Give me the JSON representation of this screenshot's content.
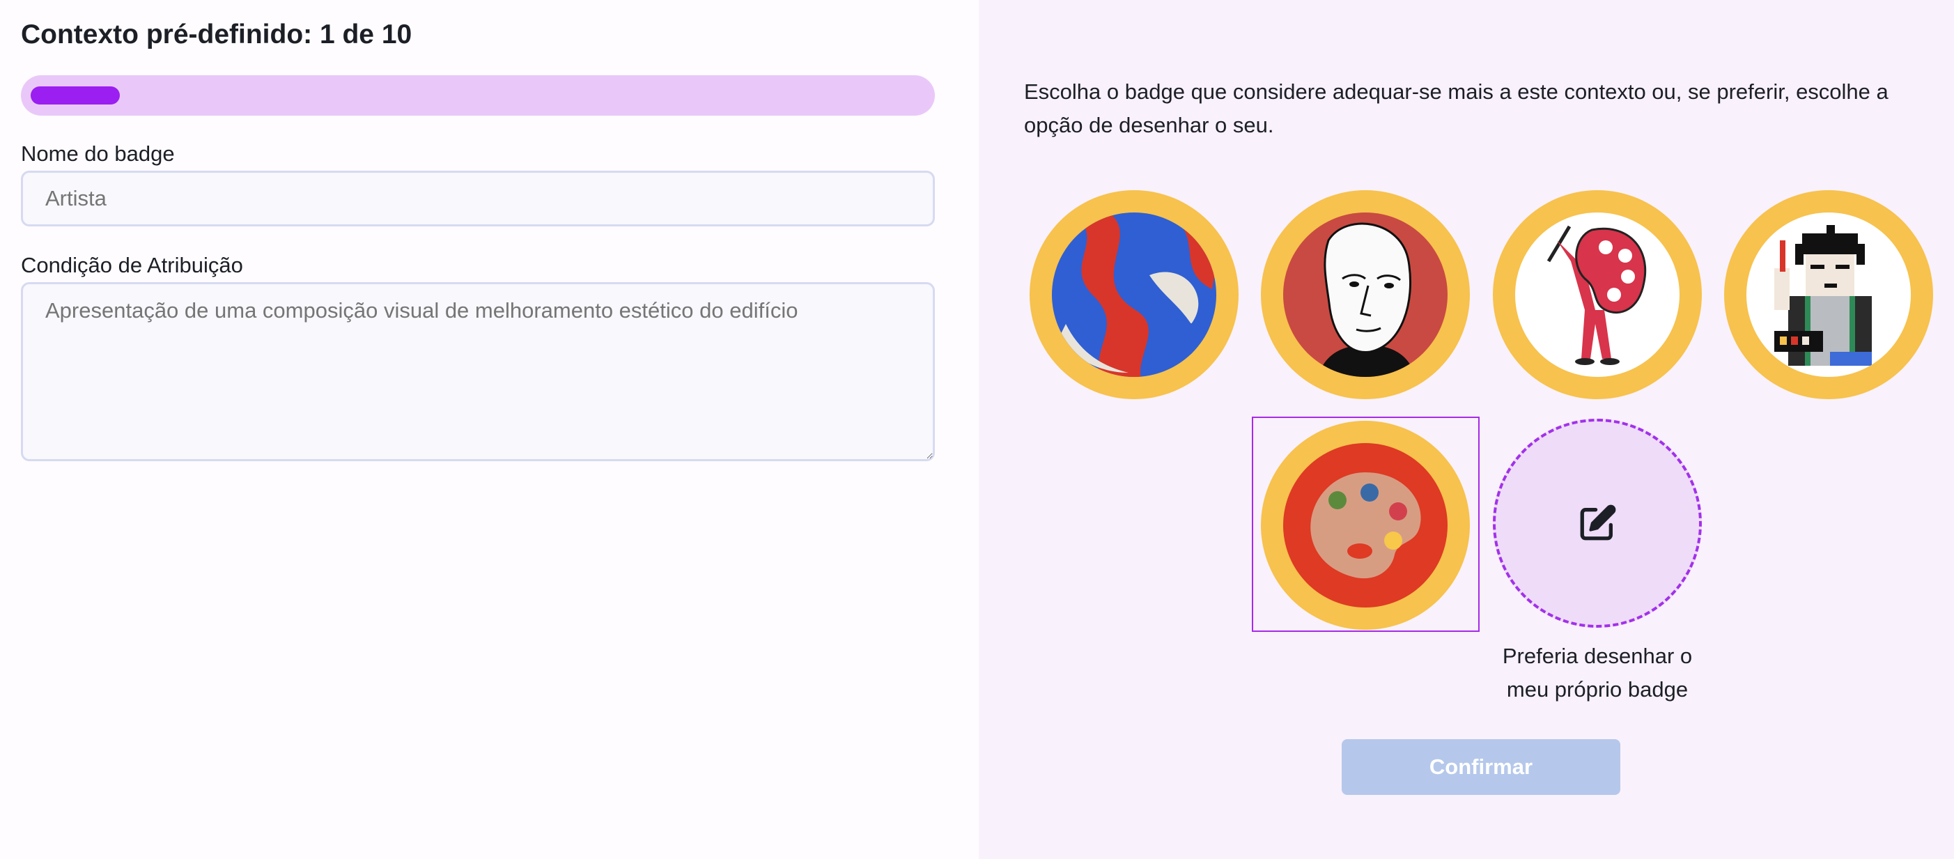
{
  "context": {
    "title": "Contexto pré-definido: 1 de 10",
    "progress_fraction": 0.1
  },
  "form": {
    "name_label": "Nome do badge",
    "name_placeholder": "Artista",
    "condition_label": "Condição de Atribuição",
    "condition_placeholder": "Apresentação de uma composição visual de melhoramento estético do edifício"
  },
  "picker": {
    "intro": "Escolha o badge que considere adequar-se mais a este contexto ou, se preferir, escolhe a opção de desenhar o seu.",
    "badges": [
      {
        "icon": "abstract-swirl-badge-icon"
      },
      {
        "icon": "face-portrait-badge-icon"
      },
      {
        "icon": "painter-with-palette-badge-icon"
      },
      {
        "icon": "pixel-artist-badge-icon"
      },
      {
        "icon": "paint-palette-badge-icon",
        "selected": true
      }
    ],
    "draw_own_label": "Preferia desenhar o meu próprio badge",
    "draw_own_icon": "edit-pencil-icon",
    "confirm_label": "Confirmar"
  },
  "colors": {
    "accent": "#9b1ff0",
    "badge_ring": "#f7c24d",
    "confirm_disabled": "#b5c8eb"
  }
}
